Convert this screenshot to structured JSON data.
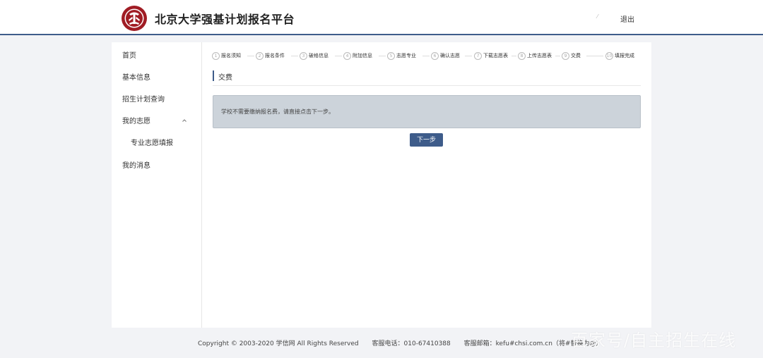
{
  "header": {
    "site_title": "北京大学强基计划报名平台",
    "user_name": "⁄",
    "logout_label": "退出"
  },
  "sidebar": {
    "items": [
      {
        "label": "首页"
      },
      {
        "label": "基本信息"
      },
      {
        "label": "招生计划查询"
      },
      {
        "label": "我的志愿",
        "expanded": true,
        "icon": "chevron-up-icon"
      },
      {
        "label": "专业志愿填报"
      },
      {
        "label": "我的消息"
      }
    ]
  },
  "steps": [
    {
      "num": "1",
      "label": "报名须知"
    },
    {
      "num": "2",
      "label": "报名条件"
    },
    {
      "num": "3",
      "label": "破格信息"
    },
    {
      "num": "4",
      "label": "附加信息"
    },
    {
      "num": "5",
      "label": "志愿专业"
    },
    {
      "num": "6",
      "label": "确认志愿"
    },
    {
      "num": "7",
      "label": "下载志愿表"
    },
    {
      "num": "8",
      "label": "上传志愿表"
    },
    {
      "num": "9",
      "label": "交费"
    },
    {
      "num": "10",
      "label": "填报完成"
    }
  ],
  "section": {
    "title": "交费",
    "notice": "学校不需要缴纳报名费，请直接点击下一步。",
    "next_label": "下一步"
  },
  "footer": {
    "copyright": "Copyright © 2003-2020 学信网 All Rights Reserved",
    "phone": "客服电话：010-67410388",
    "email": "客服邮箱：kefu#chsi.com.cn（将#替换为@）"
  },
  "watermark": "百家号/自主招生在线",
  "colors": {
    "accent": "#3e5c8a",
    "logo_red": "#a01c24",
    "notice_bg": "#ccd3da"
  }
}
